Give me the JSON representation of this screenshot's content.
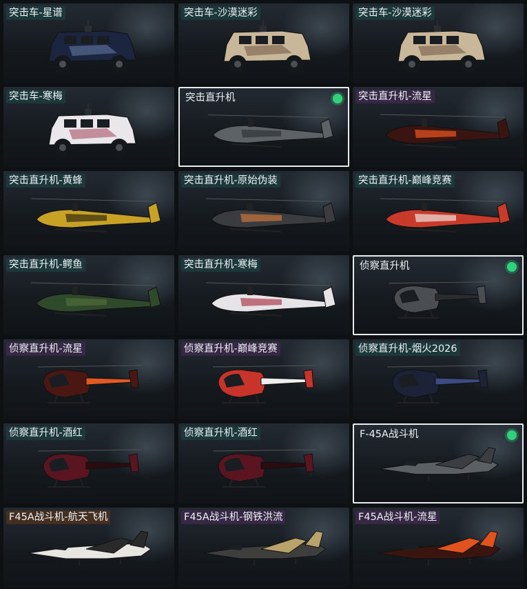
{
  "items": [
    {
      "label": "突击车-星谱",
      "vehicle": "armored-car",
      "skin": "starmap",
      "colors": [
        "#1c2540",
        "#6a7fa6"
      ],
      "tag": "teal",
      "selected": false
    },
    {
      "label": "突击车-沙漠迷彩",
      "vehicle": "armored-car",
      "skin": "desert-camo",
      "colors": [
        "#c9b79a",
        "#6d5842"
      ],
      "tag": "teal",
      "selected": false
    },
    {
      "label": "突击车-沙漠迷彩",
      "vehicle": "armored-car",
      "skin": "desert-camo",
      "colors": [
        "#c9b79a",
        "#6d5842"
      ],
      "tag": "teal",
      "selected": false
    },
    {
      "label": "突击车-寒梅",
      "vehicle": "armored-car",
      "skin": "plum",
      "colors": [
        "#e9e7ea",
        "#a2465a"
      ],
      "tag": "teal",
      "selected": false
    },
    {
      "label": "突击直升机",
      "vehicle": "attack-helicopter",
      "skin": "default",
      "colors": [
        "#5d6266",
        "#33383c"
      ],
      "tag": "none",
      "selected": true
    },
    {
      "label": "突击直升机-流星",
      "vehicle": "attack-helicopter",
      "skin": "meteor",
      "colors": [
        "#3a1410",
        "#e0501d"
      ],
      "tag": "purple",
      "selected": false
    },
    {
      "label": "突击直升机-黄蜂",
      "vehicle": "attack-helicopter",
      "skin": "hornet",
      "colors": [
        "#c7a224",
        "#3d3212"
      ],
      "tag": "teal",
      "selected": false
    },
    {
      "label": "突击直升机-原始伪装",
      "vehicle": "attack-helicopter",
      "skin": "primal-camo",
      "colors": [
        "#3b3c40",
        "#c0703a"
      ],
      "tag": "teal",
      "selected": false
    },
    {
      "label": "突击直升机-巅峰竞赛",
      "vehicle": "attack-helicopter",
      "skin": "peak-race",
      "colors": [
        "#c83a2a",
        "#e9d7d2"
      ],
      "tag": "teal",
      "selected": false
    },
    {
      "label": "突击直升机-鳄鱼",
      "vehicle": "attack-helicopter",
      "skin": "crocodile",
      "colors": [
        "#2f4a2a",
        "#4f6a3a"
      ],
      "tag": "teal",
      "selected": false
    },
    {
      "label": "突击直升机-寒梅",
      "vehicle": "attack-helicopter",
      "skin": "plum",
      "colors": [
        "#e6e4e6",
        "#b04a58"
      ],
      "tag": "teal",
      "selected": false
    },
    {
      "label": "侦察直升机",
      "vehicle": "scout-helicopter",
      "skin": "default",
      "colors": [
        "#4a4e52",
        "#2a2d30"
      ],
      "tag": "none",
      "selected": true
    },
    {
      "label": "侦察直升机-流星",
      "vehicle": "scout-helicopter",
      "skin": "meteor",
      "colors": [
        "#4a1712",
        "#e25a22"
      ],
      "tag": "purple",
      "selected": false
    },
    {
      "label": "侦察直升机-巅峰竞赛",
      "vehicle": "scout-helicopter",
      "skin": "peak-race",
      "colors": [
        "#c9342a",
        "#eeeeee"
      ],
      "tag": "purple",
      "selected": false
    },
    {
      "label": "侦察直升机-烟火2026",
      "vehicle": "scout-helicopter",
      "skin": "fireworks-2026",
      "colors": [
        "#1c2338",
        "#3a4c82"
      ],
      "tag": "teal",
      "selected": false
    },
    {
      "label": "侦察直升机-酒红",
      "vehicle": "scout-helicopter",
      "skin": "wine-red",
      "colors": [
        "#5a1520",
        "#2a0c10"
      ],
      "tag": "teal",
      "selected": false
    },
    {
      "label": "侦察直升机-酒红",
      "vehicle": "scout-helicopter",
      "skin": "wine-red",
      "colors": [
        "#5a1520",
        "#2a0c10"
      ],
      "tag": "teal",
      "selected": false
    },
    {
      "label": "F-45A战斗机",
      "vehicle": "fighter-jet",
      "skin": "default",
      "colors": [
        "#5b6065",
        "#3a3e42"
      ],
      "tag": "none",
      "selected": true
    },
    {
      "label": "F45A战斗机-航天飞机",
      "vehicle": "fighter-jet",
      "skin": "space-shuttle",
      "colors": [
        "#e8e6e1",
        "#2a2a2a"
      ],
      "tag": "brown",
      "selected": false
    },
    {
      "label": "F45A战斗机-钢铁洪流",
      "vehicle": "fighter-jet",
      "skin": "steel-torrent",
      "colors": [
        "#3e3f3c",
        "#b9a36a"
      ],
      "tag": "purple",
      "selected": false
    },
    {
      "label": "F45A战斗机-流星",
      "vehicle": "fighter-jet",
      "skin": "meteor",
      "colors": [
        "#3a140f",
        "#e1521e"
      ],
      "tag": "purple",
      "selected": false
    }
  ],
  "selected_indicator_color": "#2fd27a"
}
